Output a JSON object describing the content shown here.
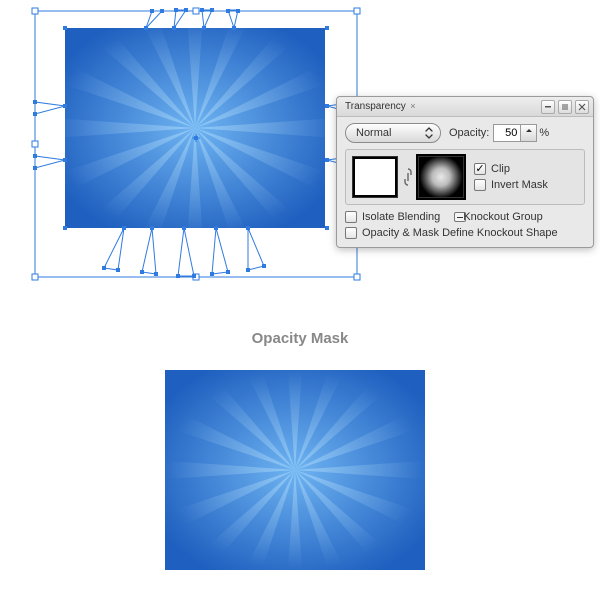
{
  "panel": {
    "title": "Transparency",
    "blendMode": "Normal",
    "opacityLabel": "Opacity:",
    "opacityValue": "50",
    "opacityUnit": "%",
    "clip": {
      "label": "Clip",
      "checked": true
    },
    "invertMask": {
      "label": "Invert Mask",
      "checked": false
    },
    "isolate": {
      "label": "Isolate Blending",
      "checked": false
    },
    "knockout": {
      "label": "Knockout Group",
      "checked": false
    },
    "defineKnockout": {
      "label": "Opacity & Mask Define Knockout Shape",
      "checked": false
    }
  },
  "caption": "Opacity Mask",
  "art": {
    "bg_outer": "#1f5fbf",
    "bg_inner": "#6fb4f2",
    "ray_color": "#b9e1fb",
    "selection_color": "#2f7be0"
  }
}
